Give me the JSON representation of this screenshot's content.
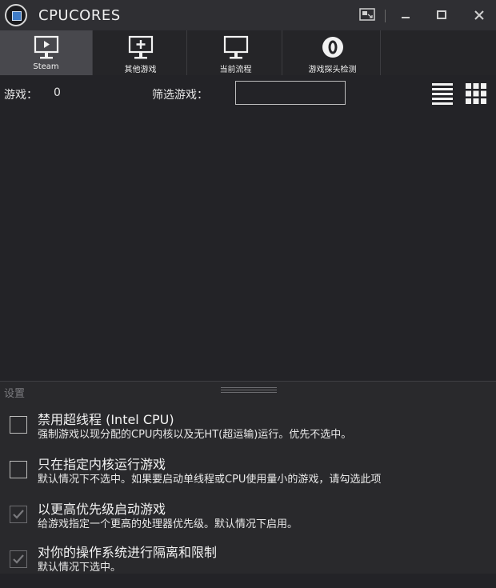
{
  "app": {
    "title": "CPUCORES"
  },
  "tabs": [
    {
      "label": "Steam",
      "icon": "monitor-play-icon",
      "active": true
    },
    {
      "label": "其他游戏",
      "icon": "monitor-plus-icon",
      "active": false
    },
    {
      "label": "当前流程",
      "icon": "monitor-icon",
      "active": false
    },
    {
      "label": "游戏探头检测",
      "icon": "probe-icon",
      "active": false
    }
  ],
  "toolbar": {
    "games_label": "游戏：",
    "games_count": "0",
    "filter_label": "筛选游戏：",
    "filter_value": "",
    "list_view_icon": "list-view-icon",
    "grid_view_icon": "grid-view-icon"
  },
  "settings": {
    "title": "设置",
    "options": [
      {
        "title": "禁用超线程 (Intel CPU)",
        "desc": "强制游戏以现分配的CPU内核以及无HT(超运输)运行。优先不选中。",
        "checked": false
      },
      {
        "title": "只在指定内核运行游戏",
        "desc": "默认情况下不选中。如果要启动单线程或CPU使用量小的游戏，请勾选此项",
        "checked": false
      },
      {
        "title": "以更高优先级启动游戏",
        "desc": "给游戏指定一个更高的处理器优先级。默认情况下启用。",
        "checked": true
      },
      {
        "title": "对你的操作系统进行隔离和限制",
        "desc": "默认情况下选中。",
        "checked": true
      }
    ]
  },
  "colors": {
    "background": "#232327",
    "titlebar": "#2f2f33",
    "active_tab": "#48484d",
    "accent": "#3f7cc8"
  }
}
